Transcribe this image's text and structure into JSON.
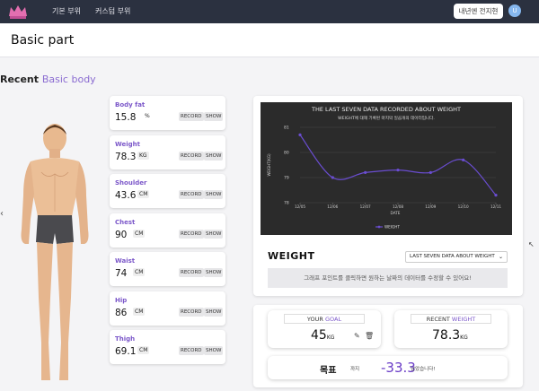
{
  "nav": {
    "links": [
      "기본 부위",
      "커스텀 부위"
    ],
    "user_button": "내년엔 전지현",
    "avatar_letter": "U"
  },
  "page": {
    "title": "Basic part"
  },
  "section": {
    "title": "Recent",
    "subtitle": "Basic body"
  },
  "metrics": [
    {
      "label": "Body fat",
      "value": "15.8",
      "unit": "%",
      "record": "RECORD",
      "show": "SHOW"
    },
    {
      "label": "Weight",
      "value": "78.3",
      "unit": "KG",
      "record": "RECORD",
      "show": "SHOW"
    },
    {
      "label": "Shoulder",
      "value": "43.6",
      "unit": "CM",
      "record": "RECORD",
      "show": "SHOW"
    },
    {
      "label": "Chest",
      "value": "90",
      "unit": "CM",
      "record": "RECORD",
      "show": "SHOW"
    },
    {
      "label": "Waist",
      "value": "74",
      "unit": "CM",
      "record": "RECORD",
      "show": "SHOW"
    },
    {
      "label": "Hip",
      "value": "86",
      "unit": "CM",
      "record": "RECORD",
      "show": "SHOW"
    },
    {
      "label": "Thigh",
      "value": "69.1",
      "unit": "CM",
      "record": "RECORD",
      "show": "SHOW"
    }
  ],
  "chart_data": {
    "type": "line",
    "title": "THE LAST SEVEN DATA RECORDED ABOUT WEIGHT",
    "subtitle": "WEIGHT에 대해 기록된 마지막 일곱개의 데이터입니다.",
    "ylabel": "WEIGHT(KG)",
    "xlabel": "DATE",
    "x": [
      "12/05",
      "12/06",
      "12/07",
      "12/08",
      "12/09",
      "12/10",
      "12/11"
    ],
    "y_ticks": [
      "81",
      "80",
      "79",
      "78"
    ],
    "ylim": [
      78,
      81
    ],
    "series": [
      {
        "name": "WEIGHT",
        "color": "#6a4dd1",
        "values": [
          80.7,
          79.0,
          79.2,
          79.3,
          79.2,
          79.7,
          78.3
        ]
      }
    ],
    "background": "#2b2b2b",
    "grid": true,
    "legend": "bottom-center"
  },
  "weight_section": {
    "title": "WEIGHT",
    "select_value": "LAST SEVEN DATA ABOUT WEIGHT",
    "note": "그래프 포인트를 클릭하면 원하는 날짜의 데이터를 수정할 수 있어요!"
  },
  "goal": {
    "tag_prefix": "YOUR",
    "tag_hl": "GOAL",
    "value": "45",
    "unit": "KG"
  },
  "recent_weight": {
    "tag_prefix": "RECENT",
    "tag_hl": "WEIGHT",
    "value": "78.3",
    "unit": "KG"
  },
  "target": {
    "label": "목표",
    "until": "까지",
    "diff": "-33.3",
    "remaining": "남았습니다!"
  },
  "colors": {
    "accent": "#7b57c9",
    "nav_bg": "#2b3140",
    "chart_bg": "#2b2b2b"
  },
  "icons": {
    "edit": "pencil-icon",
    "delete": "trash-icon",
    "back": "chevron-left-icon",
    "caret": "chevron-down-icon"
  }
}
